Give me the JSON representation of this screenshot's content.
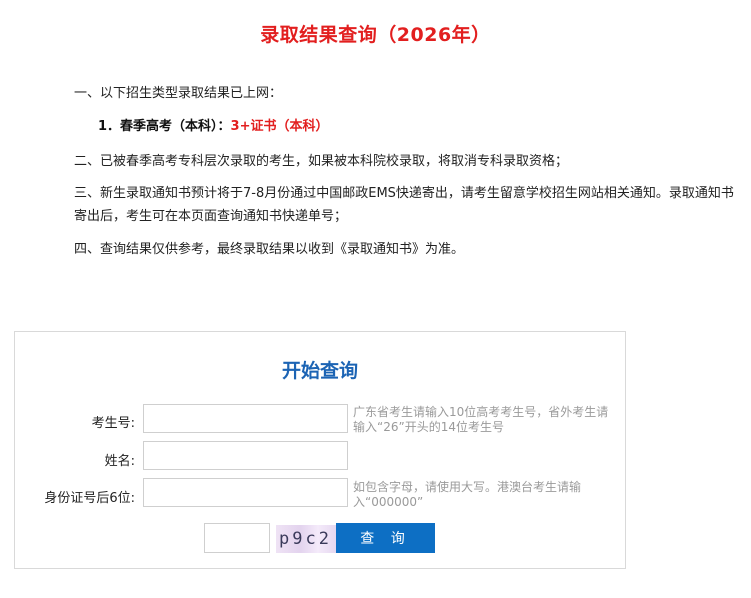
{
  "page": {
    "title": "录取结果查询（2026年）"
  },
  "notice": {
    "item1": "一、以下招生类型录取结果已上网：",
    "item1_sub_prefix": "1．春季高考（本科）：",
    "item1_sub_value": "3+证书（本科）",
    "item2": "二、已被春季高考专科层次录取的考生，如果被本科院校录取，将取消专科录取资格；",
    "item3": "三、新生录取通知书预计将于7-8月份通过中国邮政EMS快递寄出，请考生留意学校招生网站相关通知。录取通知书寄出后，考生可在本页面查询通知书快递单号；",
    "item4": "四、查询结果仅供参考，最终录取结果以收到《录取通知书》为准。"
  },
  "form": {
    "heading": "开始查询",
    "exam_no_label": "考生号:",
    "exam_no_value": "",
    "exam_no_hint": "广东省考生请输入10位高考考生号，省外考生请输入“26”开头的14位考生号",
    "name_label": "姓名:",
    "name_value": "",
    "id_label": "身份证号后6位:",
    "id_value": "",
    "id_hint": "如包含字母，请使用大写。港澳台考生请输入“000000”",
    "captcha_value": "",
    "captcha_text": "p9c2",
    "submit_label": "查 询"
  },
  "colors": {
    "title_red": "#e21f1f",
    "heading_blue": "#1c64b4",
    "button_blue": "#0d6fc4"
  }
}
